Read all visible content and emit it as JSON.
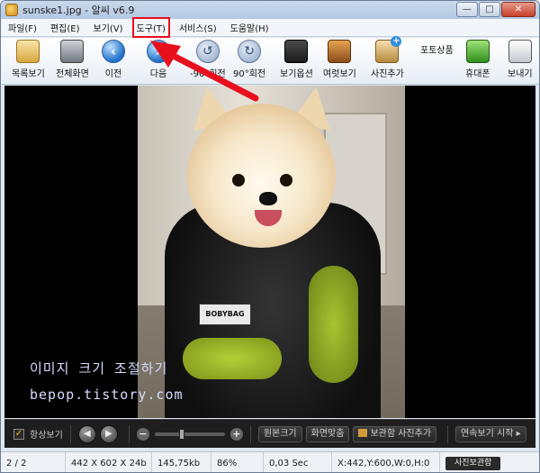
{
  "window": {
    "title": "sunske1.jpg - 알씨 v6.9"
  },
  "menu": [
    "파일(F)",
    "편집(E)",
    "보기(V)",
    "도구(T)",
    "서비스(S)",
    "도움말(H)"
  ],
  "toolbar": {
    "list": "목록보기",
    "fullscreen": "전체화면",
    "prev": "이전",
    "next": "다음",
    "rotate_left": "-90°회전",
    "rotate_right": "90°회전",
    "view_options": "보기옵션",
    "multi_view": "여럿보기",
    "add_photo": "사진추가",
    "photo_product": "포토상품",
    "phone": "휴대폰",
    "send": "보내기"
  },
  "photo": {
    "tag": "BOBYBAG"
  },
  "watermark": {
    "line1": "이미지 크기 조절하기",
    "line2": "bepop.tistory.com"
  },
  "controls": {
    "always_view": "항상보기",
    "original_size": "원본크기",
    "fit_screen": "화면맞춤",
    "add_to_storage": "보관함 사진추가",
    "slideshow": "연속보기 시작",
    "zoom_level": 0.35
  },
  "status": {
    "page": "2 / 2",
    "dimensions": "442 X 602 X 24b",
    "filesize": "145,75kb",
    "zoom": "86%",
    "time": "0,03 Sec",
    "coords": "X:442,Y:600,W:0,H:0",
    "storage_button": "사진보관함"
  },
  "colors": {
    "highlight": "#e8101d",
    "canvas": "#000000"
  }
}
